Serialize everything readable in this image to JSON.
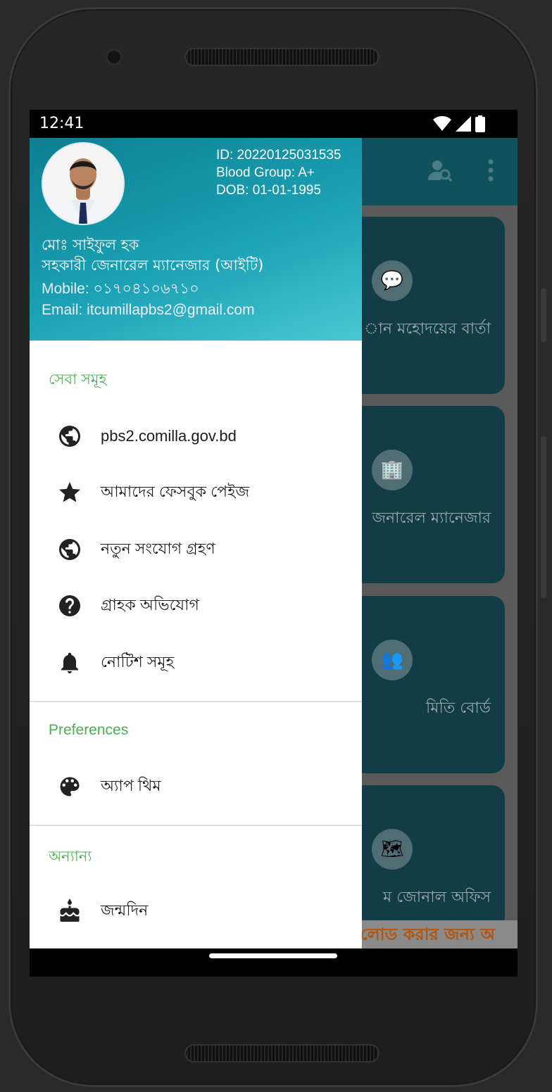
{
  "status_bar": {
    "time": "12:41"
  },
  "drawer": {
    "header": {
      "id_line": "ID: 20220125031535",
      "blood_line": "Blood Group: A+",
      "dob_line": "DOB: 01-01-1995",
      "name": "মোঃ সাইফুল হক",
      "designation": "সহকারী জেনারেল ম্যানেজার (আইটি)",
      "mobile": "Mobile: ০১৭০৪১০৬৭১০",
      "email": "Email: itcumillapbs2@gmail.com"
    },
    "sections": [
      {
        "title": "সেবা সমূহ",
        "items": [
          {
            "label": "pbs2.comilla.gov.bd",
            "icon": "globe-icon"
          },
          {
            "label": "আমাদের ফেসবুক পেইজ",
            "icon": "star-icon"
          },
          {
            "label": "নতুন সংযোগ গ্রহণ",
            "icon": "globe-icon"
          },
          {
            "label": "গ্রাহক অভিযোগ",
            "icon": "help-icon"
          },
          {
            "label": "নোটিশ সমূহ",
            "icon": "bell-icon"
          }
        ]
      },
      {
        "title": "Preferences",
        "items": [
          {
            "label": "অ্যাপ থিম",
            "icon": "palette-icon"
          }
        ]
      },
      {
        "title": "অন্যান্য",
        "items": [
          {
            "label": "জন্মদিন",
            "icon": "cake-icon"
          }
        ]
      }
    ]
  },
  "background": {
    "cards": [
      {
        "label": "ান মহোদয়ের বার্তা",
        "icon": "chat-icon"
      },
      {
        "label": "জনারেল ম্যানেজার",
        "icon": "building-icon"
      },
      {
        "label": "মিতি বোর্ড",
        "icon": "board-icon"
      },
      {
        "label": "ম জোনাল অফিস",
        "icon": "office-icon"
      }
    ],
    "marquee": "লোড করার জন্য অ"
  },
  "colors": {
    "header_start": "#0d7f92",
    "header_end": "#48c8d6",
    "section_title": "#4caf50",
    "appbar": "#10525c"
  }
}
